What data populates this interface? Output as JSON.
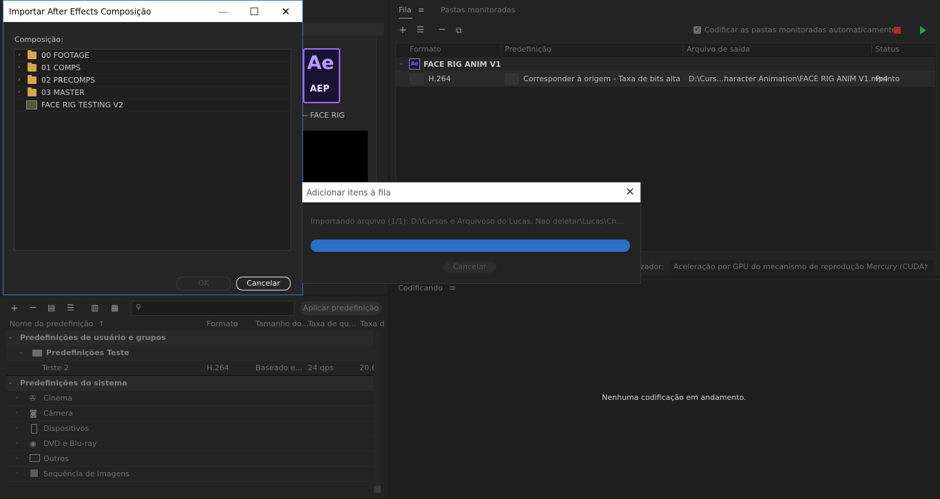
{
  "import_dialog": {
    "title": "Importar After Effects Composição",
    "minimize": "—",
    "maximize": "☐",
    "close": "✕",
    "comp_label": "Composição:",
    "tree": [
      {
        "label": "00 FOOTAGE",
        "type": "folder"
      },
      {
        "label": "01 COMPS",
        "type": "folder"
      },
      {
        "label": "02 PRECOMPS",
        "type": "folder"
      },
      {
        "label": "03 MASTER",
        "type": "folder"
      },
      {
        "label": "FACE RIG TESTING V2",
        "type": "composition"
      }
    ],
    "ok_label": "OK",
    "cancel_label": "Cancelar"
  },
  "preview": {
    "ae_text": "Ae",
    "aep_text": "AEP",
    "name": "-- FACE RIG"
  },
  "queue": {
    "tab_queue": "Fila",
    "tab_watch": "Pastas monitoradas",
    "auto_encode_label": "Codificar as pastas monitoradas automaticamente",
    "columns": [
      "Formato",
      "Predefinição",
      "Arquivo de saída",
      "Status"
    ],
    "group_name": "FACE RIG ANIM V1",
    "group_icon_text": "Ae",
    "item": {
      "format": "H.264",
      "preset": "Corresponder à origem - Taxa de bits alta",
      "output": "D:\\Curs...haracter Animation\\FACE RIG ANIM V1.mp4",
      "status": "Pronto"
    },
    "renderer_label": "zador:",
    "renderer_value": "Aceleração por GPU do mecanismo de reprodução Mercury (CUDA)"
  },
  "progress_dialog": {
    "title": "Adicionar itens à fila",
    "close": "✕",
    "text": "Importando arquivo (1/1): D:\\Cursos e Arquivoso do Lucas, Nao deletar\\Lucas\\Character Ani...",
    "progress": 1.0,
    "cancel_label": "Cancelar"
  },
  "encoding": {
    "tab": "Codificando",
    "empty_message": "Nenhuma codificação em andamento."
  },
  "presets": {
    "apply_label": "Aplicar predefinição",
    "columns": [
      "Nome da predefinição",
      "Formato",
      "Tamanho do...",
      "Taxa de qu...",
      "Taxa d"
    ],
    "user_group": "Predefinições de usuário e grupos",
    "user_subgroup": "Predefinições Teste",
    "user_preset": {
      "name": "Teste 2",
      "format": "H.264",
      "size": "Baseado e...",
      "rate": "24 qps",
      "bitrate": "20,6"
    },
    "system_group": "Predefinições do sistema",
    "system_items": [
      "Cinema",
      "Câmera",
      "Dispositivos",
      "DVD e Blu-ray",
      "Outros",
      "Sequência de imagens"
    ]
  },
  "colors": {
    "accent_blue": "#2b6fc7",
    "stop_red": "#b3262b",
    "play_green": "#2ea043"
  }
}
